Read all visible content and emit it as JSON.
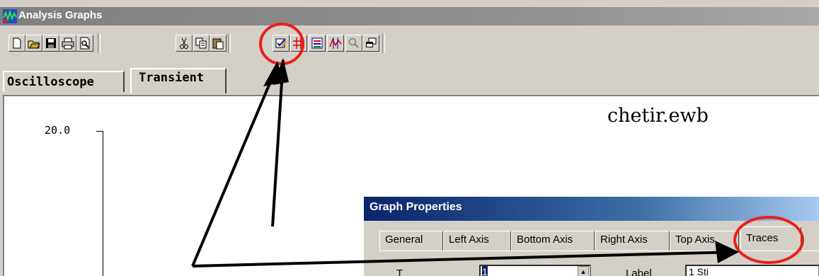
{
  "window": {
    "title": "Analysis Graphs"
  },
  "toolbar": {
    "buttons": [
      "new-icon",
      "open-icon",
      "save-icon",
      "print-icon",
      "print-preview-icon",
      "cut-icon",
      "copy-icon",
      "paste-icon",
      "properties-icon",
      "grid-icon",
      "legend-icon",
      "cursors-icon",
      "zoom-icon",
      "restore-icon"
    ]
  },
  "tabs": {
    "oscilloscope": "Oscilloscope",
    "transient": "Transient"
  },
  "plot": {
    "y_top_tick": "20.0",
    "file_name": "chetir.ewb"
  },
  "dialog": {
    "title": "Graph Properties",
    "tabs": [
      "General",
      "Left Axis",
      "Bottom Axis",
      "Right Axis",
      "Top Axis",
      "Traces"
    ],
    "active_tab": "Traces",
    "trace_label": "T",
    "trace_value": "1",
    "label_label": "Label",
    "label_value": "1 Sti"
  },
  "colors": {
    "annotation": "#e8201a",
    "arrow": "#000000"
  }
}
